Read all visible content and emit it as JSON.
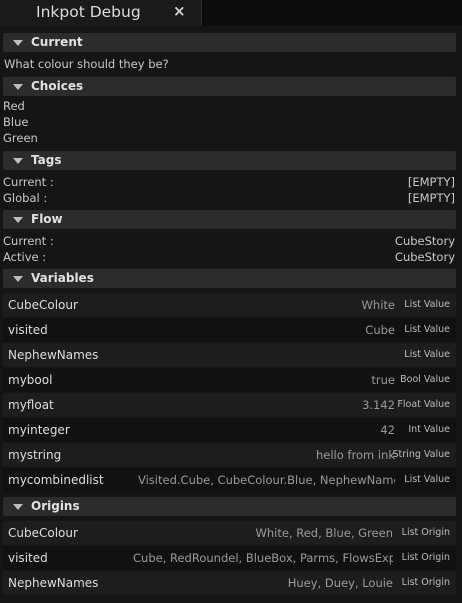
{
  "window": {
    "tab_title": "Inkpot Debug",
    "close_glyph": "×"
  },
  "current": {
    "header": "Current",
    "text": "What colour should they be?"
  },
  "choices": {
    "header": "Choices",
    "items": [
      "Red",
      "Blue",
      "Green"
    ]
  },
  "tags": {
    "header": "Tags",
    "rows": [
      {
        "label": "Current :",
        "value": "[EMPTY]"
      },
      {
        "label": "Global :",
        "value": "[EMPTY]"
      }
    ]
  },
  "flow": {
    "header": "Flow",
    "rows": [
      {
        "label": "Current :",
        "value": "CubeStory"
      },
      {
        "label": "Active :",
        "value": "CubeStory"
      }
    ]
  },
  "variables": {
    "header": "Variables",
    "rows": [
      {
        "name": "CubeColour",
        "value": "White",
        "type": "List Value"
      },
      {
        "name": "visited",
        "value": "Cube",
        "type": "List Value"
      },
      {
        "name": "NephewNames",
        "value": "",
        "type": "List Value"
      },
      {
        "name": "mybool",
        "value": "true",
        "type": "Bool Value"
      },
      {
        "name": "myfloat",
        "value": "3.142",
        "type": "Float Value"
      },
      {
        "name": "myinteger",
        "value": "42",
        "type": "Int Value"
      },
      {
        "name": "mystring",
        "value": "hello from ink",
        "type": "String Value"
      },
      {
        "name": "mycombinedlist",
        "value": "Visited.Cube, CubeColour.Blue, NephewNames",
        "type": "List Value"
      }
    ]
  },
  "origins": {
    "header": "Origins",
    "rows": [
      {
        "name": "CubeColour",
        "value": "White, Red, Blue, Green",
        "type": "List Origin"
      },
      {
        "name": "visited",
        "value": "Cube, RedRoundel, BlueBox, Parms, FlowsExp",
        "type": "List Origin"
      },
      {
        "name": "NephewNames",
        "value": "Huey, Duey, Louie",
        "type": "List Origin"
      }
    ]
  },
  "icons": {
    "section_toggle": "triangle-down-icon",
    "close": "close-icon"
  }
}
